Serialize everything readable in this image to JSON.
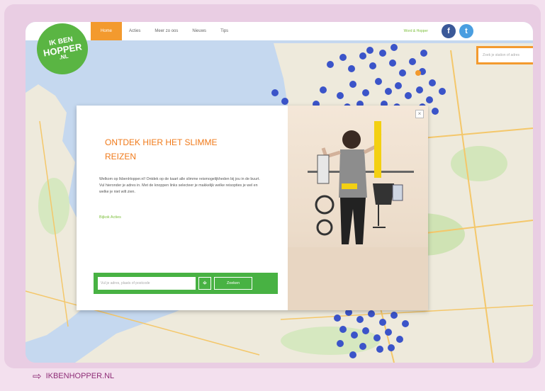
{
  "logo": {
    "line1": "IK BEN",
    "line2": "HOPPER",
    "line3": ".NL"
  },
  "nav": {
    "tabs": [
      "Home",
      "Acties",
      "Meer zo oos",
      "Nieuws",
      "Tips"
    ],
    "login": "Word & Hopper",
    "social": {
      "facebook": "f",
      "twitter": "t"
    }
  },
  "map_search": {
    "placeholder": "Zoek je station of adres"
  },
  "modal": {
    "close": "×",
    "heading": "ONTDEK HIER HET SLIMME REIZEN",
    "body": "Welkom op IkbenHopper.nl! Ontdek op de kaart alle slimme reismogelijkheden bij jou in de buurt. Vul hieronder je adres in. Met de knoppen links selecteer je makkelijk welke reisopties je wel en welke je niet wilt zien.",
    "link": "Bijkok Acties",
    "search_placeholder": "Vul je adres, plaats of postcode",
    "search_button": "Zoeken"
  },
  "caption": {
    "arrow": "⇨",
    "text": "IKBENHOPPER.NL"
  },
  "colors": {
    "accent": "#f39a2e",
    "green": "#48b243",
    "caption": "#8e2d77",
    "pin": "#3b54c9"
  }
}
